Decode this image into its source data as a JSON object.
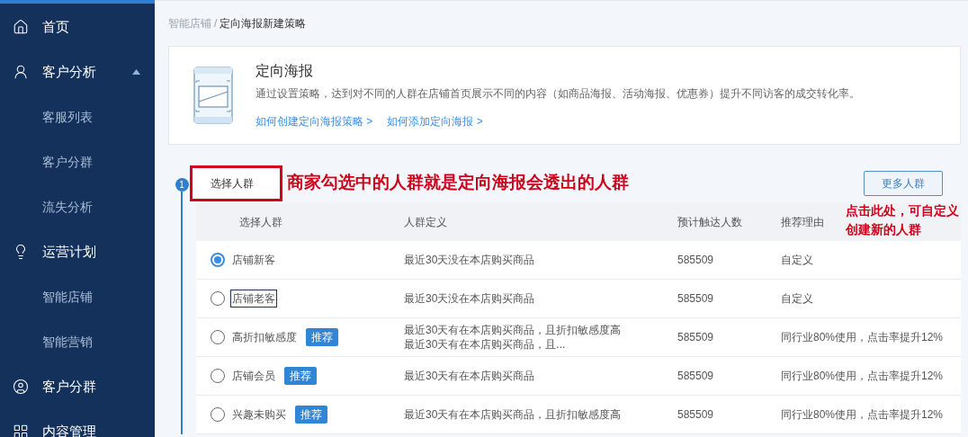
{
  "sidebar": {
    "items": [
      {
        "label": "首页"
      },
      {
        "label": "客户分析",
        "expanded": true,
        "children": [
          {
            "label": "客服列表"
          },
          {
            "label": "客户分群"
          },
          {
            "label": "流失分析"
          }
        ]
      },
      {
        "label": "运营计划",
        "children": [
          {
            "label": "智能店铺"
          },
          {
            "label": "智能营销"
          }
        ]
      },
      {
        "label": "客户分群"
      },
      {
        "label": "内容管理"
      }
    ]
  },
  "breadcrumb": {
    "parent": "智能店铺",
    "separator": "/",
    "current": "定向海报新建策略"
  },
  "intro_card": {
    "title": "定向海报",
    "description": "通过设置策略，达到对不同的人群在店铺首页展示不同的内容（如商品海报、活动海报、优惠券）提升不同访客的成交转化率。",
    "links": [
      {
        "label": "如何创建定向海报策略",
        "arrow": ">"
      },
      {
        "label": "如何添加定向海报",
        "arrow": ">"
      }
    ]
  },
  "step": {
    "number": "1",
    "title": "选择人群",
    "highlighted": true,
    "title_annotation": "商家勾选中的人群就是定向海报会透出的人群",
    "more_button": "更多人群",
    "button_annotation": "点击此处，可自定义创建新的人群"
  },
  "table": {
    "columns": [
      "选择人群",
      "人群定义",
      "预计触达人数",
      "推荐理由"
    ],
    "rows": [
      {
        "selected": true,
        "focused": false,
        "name": "店铺新客",
        "definition": [
          "最近30天没在本店购买商品"
        ],
        "reach": "585509",
        "reason": "自定义"
      },
      {
        "selected": false,
        "focused": true,
        "name": "店铺老客",
        "definition": [
          "最近30天没在本店购买商品"
        ],
        "reach": "585509",
        "reason": "自定义"
      },
      {
        "selected": false,
        "focused": false,
        "name": "高折扣敏感度",
        "badge": "推荐",
        "definition": [
          "最近30天有在本店购买商品，且折扣敏感度高",
          "最近30天有在本店购买商品，且..."
        ],
        "reach": "585509",
        "reason": "同行业80%使用，点击率提升12%"
      },
      {
        "selected": false,
        "focused": false,
        "name": "店铺会员",
        "badge": "推荐",
        "definition": [
          "最近30天有在本店购买商品"
        ],
        "reach": "585509",
        "reason": "同行业80%使用，点击率提升12%"
      },
      {
        "selected": false,
        "focused": false,
        "name": "兴趣未购买",
        "badge": "推荐",
        "definition": [
          "最近30天有在本店购买商品，且折扣敏感度高"
        ],
        "reach": "585509",
        "reason": "同行业80%使用，点击率提升12%"
      }
    ]
  }
}
